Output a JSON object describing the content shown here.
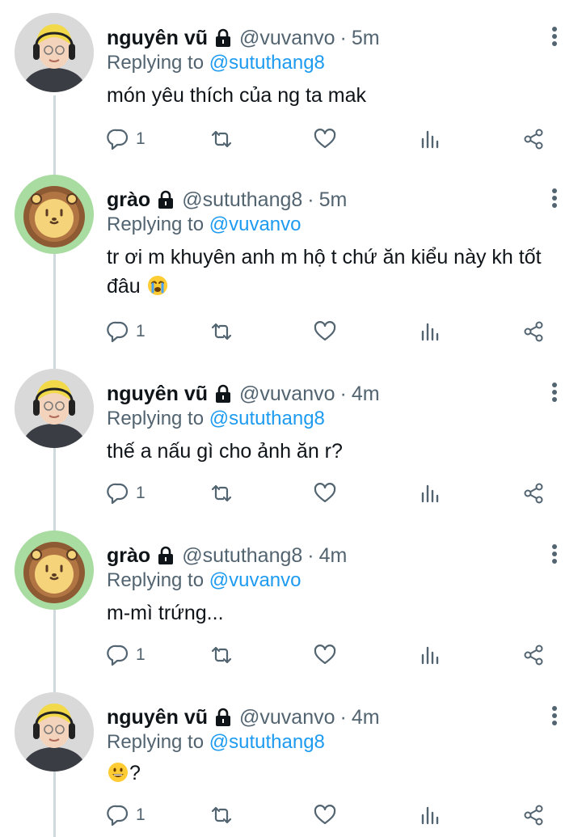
{
  "tweets": [
    {
      "name": "nguyên vũ",
      "handle": "@vuvanvo",
      "time": "5m",
      "replying_prefix": "Replying to",
      "replying_to": "@sututhang8",
      "text": "món yêu thích của ng ta mak",
      "text_emoji": "",
      "replies": "1",
      "avatar": "person-avatar"
    },
    {
      "name": "grào",
      "handle": "@sututhang8",
      "time": "5m",
      "replying_prefix": "Replying to",
      "replying_to": "@vuvanvo",
      "text": "tr ơi m khuyên anh m hộ t chứ ăn kiểu này kh tốt đâu",
      "text_emoji": "loudly-crying-face",
      "replies": "1",
      "avatar": "lion-avatar"
    },
    {
      "name": "nguyên vũ",
      "handle": "@vuvanvo",
      "time": "4m",
      "replying_prefix": "Replying to",
      "replying_to": "@sututhang8",
      "text": "thế a nấu gì cho ảnh ăn r?",
      "text_emoji": "",
      "replies": "1",
      "avatar": "person-avatar"
    },
    {
      "name": "grào",
      "handle": "@sututhang8",
      "time": "4m",
      "replying_prefix": "Replying to",
      "replying_to": "@vuvanvo",
      "text": "m-mì trứng...",
      "text_emoji": "",
      "replies": "1",
      "avatar": "lion-avatar"
    },
    {
      "name": "nguyên vũ",
      "handle": "@vuvanvo",
      "time": "4m",
      "replying_prefix": "Replying to",
      "replying_to": "@sututhang8",
      "text": "?",
      "text_emoji": "grinning-face",
      "replies": "1",
      "avatar": "person-avatar"
    }
  ],
  "separator": "·",
  "icons": {
    "reply": "reply-icon",
    "retweet": "retweet-icon",
    "like": "heart-icon",
    "views": "views-icon",
    "share": "share-icon",
    "more": "more-icon",
    "lock": "lock-icon"
  },
  "colors": {
    "text": "#0f1419",
    "muted": "#536471",
    "link": "#1d9bf0",
    "thread_line": "#cfd9de"
  }
}
